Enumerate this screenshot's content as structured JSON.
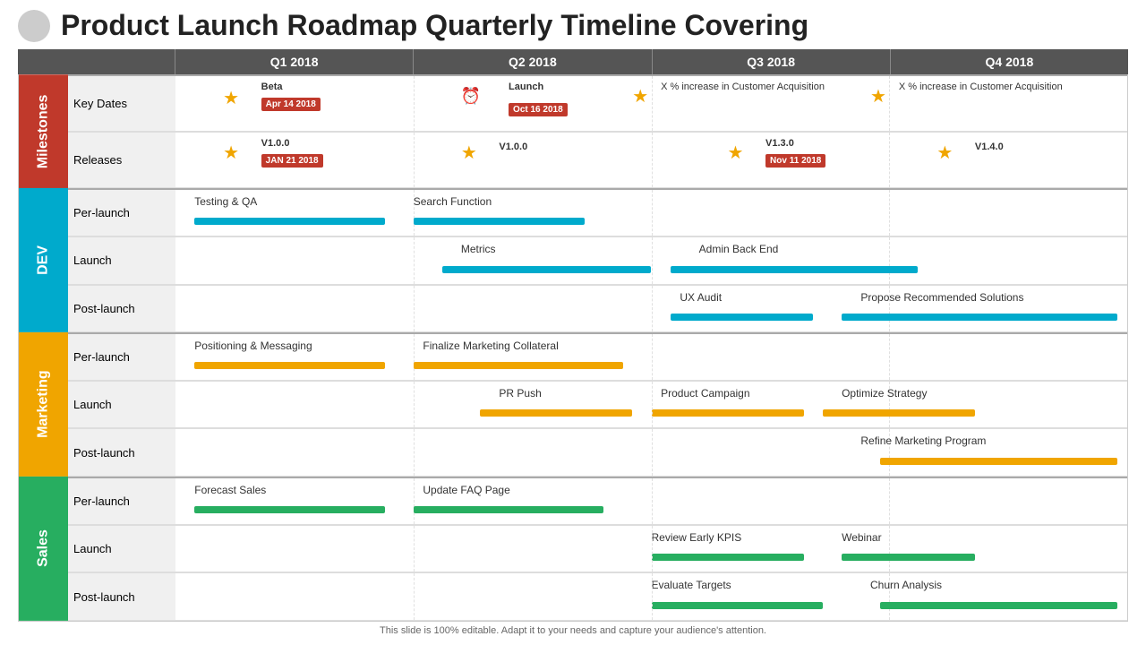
{
  "title": "Product Launch Roadmap Quarterly Timeline Covering",
  "quarters": [
    "Q1 2018",
    "Q2 2018",
    "Q3 2018",
    "Q4 2018"
  ],
  "footer": "This slide is 100% editable. Adapt it to your needs and capture your audience's attention.",
  "sections": {
    "milestones": {
      "label": "Milestones",
      "rows": [
        {
          "label": "Key Dates"
        },
        {
          "label": "Releases"
        }
      ]
    },
    "dev": {
      "label": "DEV",
      "rows": [
        {
          "label": "Per-launch"
        },
        {
          "label": "Launch"
        },
        {
          "label": "Post-launch"
        }
      ]
    },
    "marketing": {
      "label": "Marketing",
      "rows": [
        {
          "label": "Per-launch"
        },
        {
          "label": "Launch"
        },
        {
          "label": "Post-launch"
        }
      ]
    },
    "sales": {
      "label": "Sales",
      "rows": [
        {
          "label": "Per-launch"
        },
        {
          "label": "Launch"
        },
        {
          "label": "Post-launch"
        }
      ]
    }
  }
}
